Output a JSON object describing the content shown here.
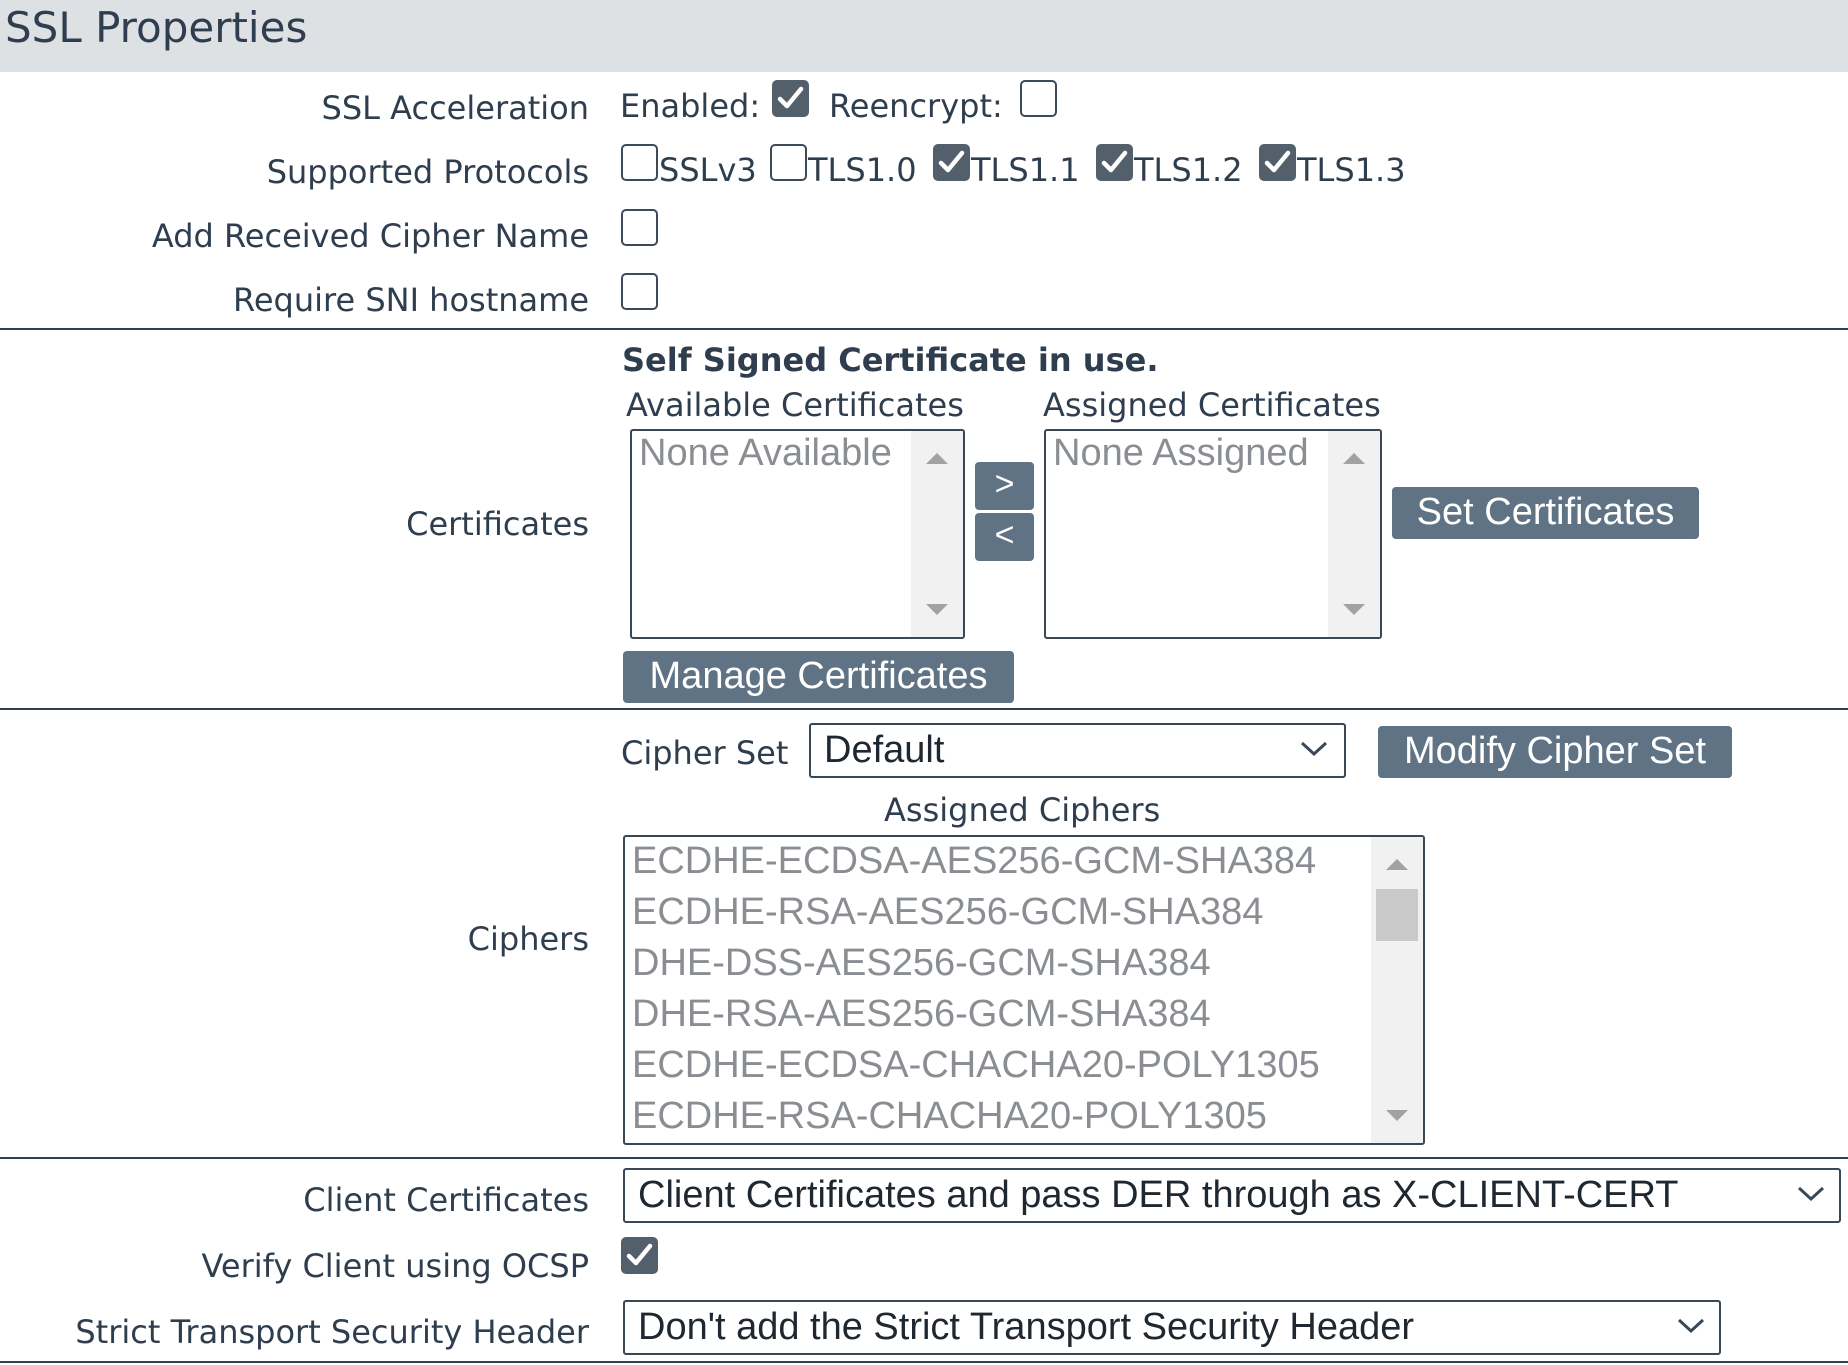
{
  "header": {
    "title": "SSL Properties"
  },
  "ssl_acceleration": {
    "label": "SSL Acceleration",
    "enabled_label": "Enabled:",
    "enabled_checked": true,
    "reencrypt_label": "Reencrypt:",
    "reencrypt_checked": false
  },
  "protocols": {
    "label": "Supported Protocols",
    "items": [
      {
        "name": "SSLv3",
        "checked": false
      },
      {
        "name": "TLS1.0",
        "checked": false
      },
      {
        "name": "TLS1.1",
        "checked": true
      },
      {
        "name": "TLS1.2",
        "checked": true
      },
      {
        "name": "TLS1.3",
        "checked": true
      }
    ]
  },
  "add_cipher_name": {
    "label": "Add Received Cipher Name",
    "checked": false
  },
  "require_sni": {
    "label": "Require SNI hostname",
    "checked": false
  },
  "certificates": {
    "label": "Certificates",
    "notice": "Self Signed Certificate in use.",
    "available_label": "Available Certificates",
    "available_items": [
      "None Available"
    ],
    "assigned_label": "Assigned Certificates",
    "assigned_items": [
      "None Assigned"
    ],
    "move_right_label": ">",
    "move_left_label": "<",
    "set_button": "Set Certificates",
    "manage_button": "Manage Certificates"
  },
  "ciphers": {
    "label": "Ciphers",
    "cipher_set_label": "Cipher Set",
    "cipher_set_value": "Default",
    "modify_button": "Modify Cipher Set",
    "assigned_label": "Assigned Ciphers",
    "assigned_items": [
      "ECDHE-ECDSA-AES256-GCM-SHA384",
      "ECDHE-RSA-AES256-GCM-SHA384",
      "DHE-DSS-AES256-GCM-SHA384",
      "DHE-RSA-AES256-GCM-SHA384",
      "ECDHE-ECDSA-CHACHA20-POLY1305",
      "ECDHE-RSA-CHACHA20-POLY1305"
    ]
  },
  "client_certificates": {
    "label": "Client Certificates",
    "value": "Client Certificates and pass DER through as X-CLIENT-CERT"
  },
  "verify_ocsp": {
    "label": "Verify Client using OCSP",
    "checked": true
  },
  "hsts": {
    "label": "Strict Transport Security Header",
    "value": "Don't add the Strict Transport Security Header"
  }
}
